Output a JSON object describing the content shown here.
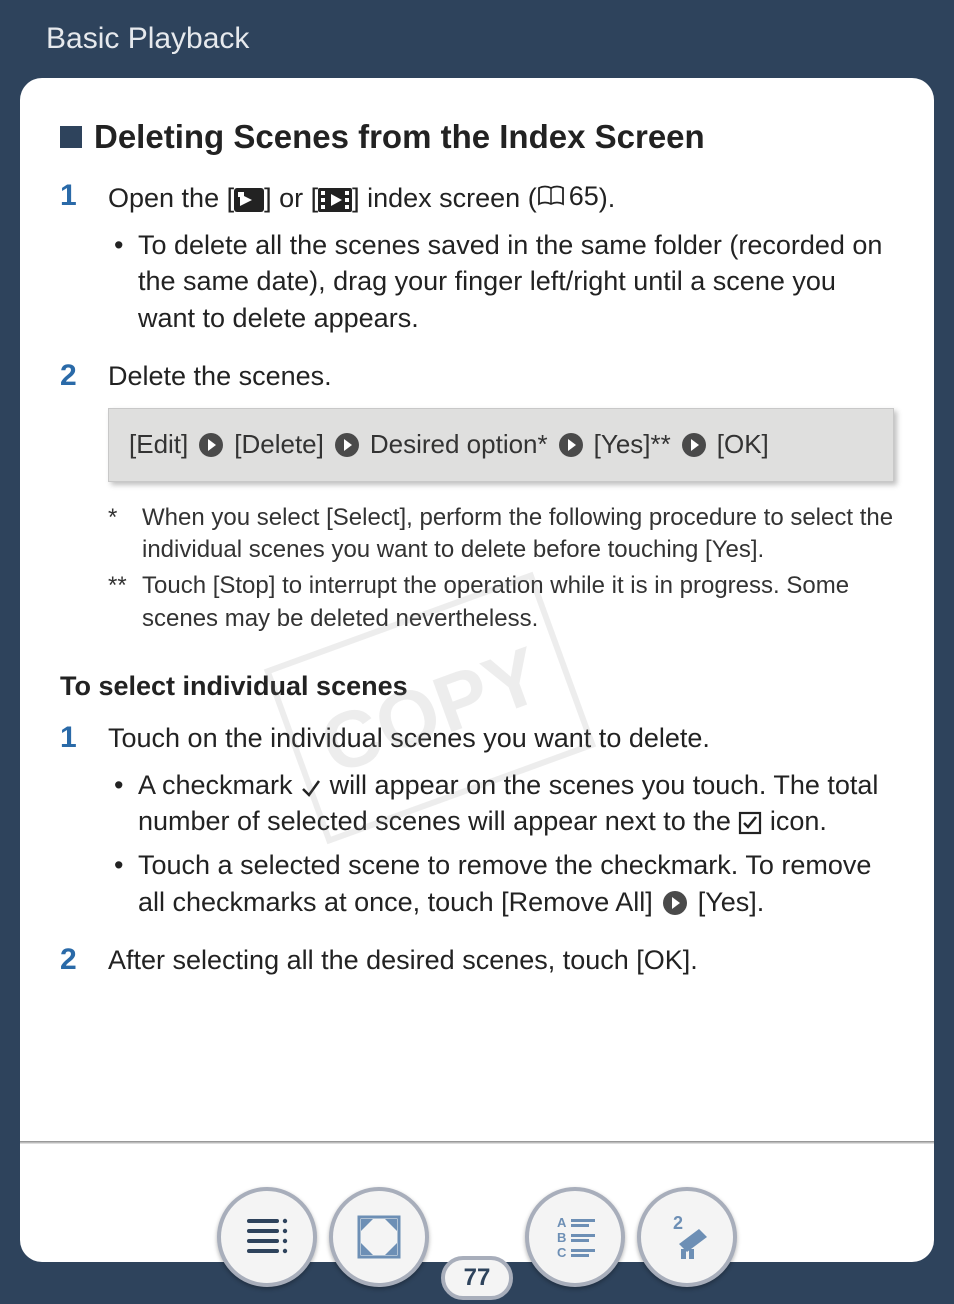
{
  "header": {
    "title": "Basic Playback"
  },
  "section": {
    "title": "Deleting Scenes from the Index Screen"
  },
  "steps_a": [
    {
      "num": "1",
      "text_pre": "Open the [",
      "text_mid": "] or [",
      "text_post": "] index screen (",
      "page_ref": "65",
      "text_close": ").",
      "bullets": [
        "To delete all the scenes saved in the same folder (recorded on the same date), drag your finger left/right until a scene you want to delete appears."
      ]
    },
    {
      "num": "2",
      "text": "Delete the scenes."
    }
  ],
  "grey_box": {
    "items": [
      "[Edit]",
      "[Delete]",
      "Desired option*",
      "[Yes]**",
      "[OK]"
    ]
  },
  "footnotes": [
    {
      "mark": "*",
      "text": "When you select [Select], perform the following procedure to select the individual scenes you want to delete before touching [Yes]."
    },
    {
      "mark": "**",
      "text": "Touch [Stop] to interrupt the operation while it is in progress. Some scenes may be deleted nevertheless."
    }
  ],
  "subhead": "To select individual scenes",
  "steps_b": [
    {
      "num": "1",
      "text": "Touch on the individual scenes you want to delete.",
      "bullets": [
        {
          "pre": "A checkmark ",
          "mid": " will appear on the scenes you touch. The total number of selected scenes will appear next to the ",
          "post": " icon."
        },
        {
          "pre": "Touch a selected scene to remove the checkmark. To remove all checkmarks at once, touch [Remove All] ",
          "post": " [Yes]."
        }
      ]
    },
    {
      "num": "2",
      "text": "After selecting all the desired scenes, touch [OK]."
    }
  ],
  "page_number": "77",
  "watermark": "COPY"
}
